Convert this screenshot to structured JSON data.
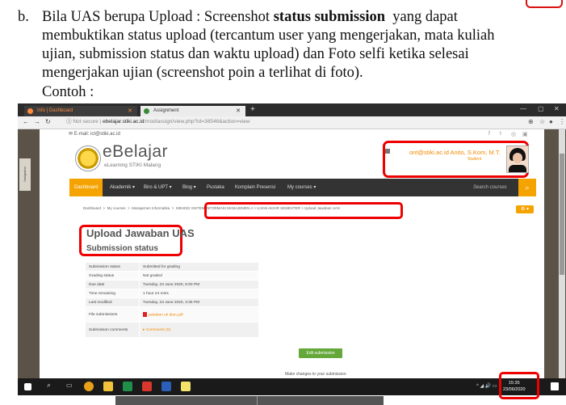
{
  "doc": {
    "bullet": "b.",
    "line1_a": "Bila UAS berupa Upload : Screenshot ",
    "line1_bold": "status submission",
    "line1_b": "  yang dapat",
    "line2": "membuktikan status upload (tercantum user yang mengerjakan, mata kuliah",
    "line3": "ujian, submission status dan waktu upload) dan Foto selfi ketika selesai",
    "line4": "mengerjakan ujian (screenshot poin a terlihat di foto).",
    "contoh": "Contoh :"
  },
  "browser": {
    "tab1": "Info | Dashboard",
    "tab2": "Assignment",
    "new_tab": "+",
    "url_prefix": "Not secure",
    "url_domain": "ebelajar.stiki.ac.id",
    "url_path": "/mod/assign/view.php?id=38546&action=view",
    "win_min": "—",
    "win_max": "▢",
    "win_close": "✕"
  },
  "site": {
    "email": "E-mail: ict@stiki.ac.id",
    "brand": "eBelajar",
    "brand_sub": "eLearning STIKI Malang",
    "user_name": "ont@stiki.ac.id Anito, S.Kom, M.T.",
    "user_role": "Student",
    "navigation_label": "Navigation"
  },
  "menu": {
    "items": [
      "Dashboard",
      "Akademik ▾",
      "Biro & UPT ▾",
      "Blog ▾",
      "Pustaka",
      "Komplain Presensi",
      "My courses ▾"
    ],
    "search_placeholder": "Search courses"
  },
  "breadcrumb": {
    "part1": "Dashboard  >  My courses  >  Manajemen Informatika  >  ",
    "part2": "MI04022 SISTEM INFORMASI MANAJEMEN A  >  UJIAN AKHIR SEMESTER  >  Upload Jawaban UAS"
  },
  "page": {
    "title": "Upload Jawaban UAS",
    "subtitle": "Submission status"
  },
  "status_table": [
    {
      "label": "Submission status",
      "value": "Submitted for grading"
    },
    {
      "label": "Grading status",
      "value": "Not graded"
    },
    {
      "label": "Due date",
      "value": "Tuesday, 23 June 2020, 5:00 PM"
    },
    {
      "label": "Time remaining",
      "value": "1 hour 24 mins"
    },
    {
      "label": "Last modified",
      "value": "Tuesday, 23 June 2020, 3:35 PM"
    },
    {
      "label": "File submissions",
      "value": "jawaban uk dian.pdf"
    },
    {
      "label": "Submission comments",
      "value": "Comments (0)"
    }
  ],
  "actions": {
    "edit_submission": "Edit submission",
    "make_changes": "Make changes to your submission"
  },
  "taskbar": {
    "time": "15:35",
    "date": "23/06/2020"
  }
}
